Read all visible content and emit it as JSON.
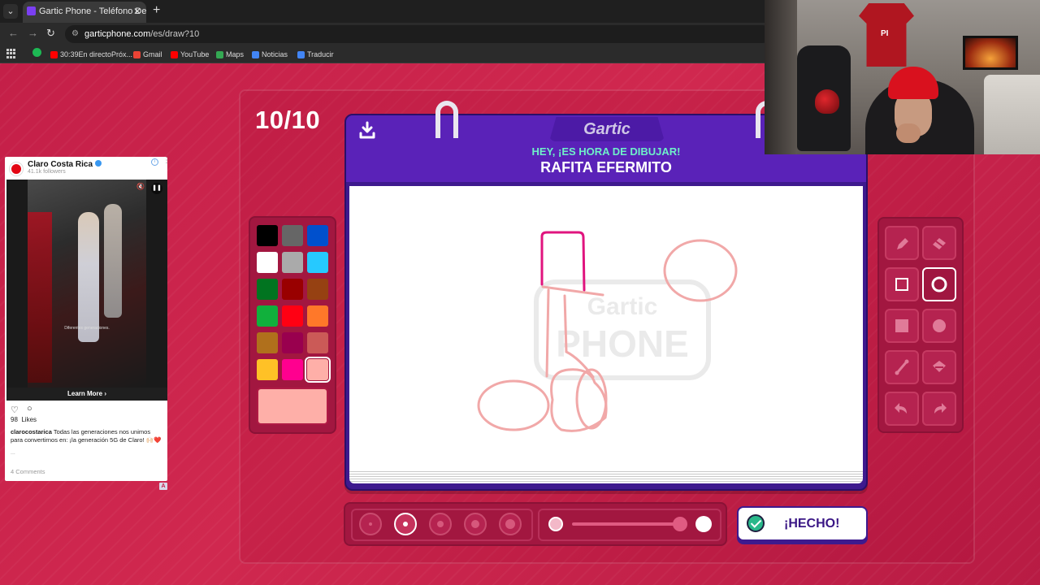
{
  "browser": {
    "tab_title": "Gartic Phone - Teléfono Descon",
    "tab_close": "✕",
    "new_tab": "+",
    "url_host": "garticphone.com",
    "url_path": "/es/draw?10",
    "bookmarks": [
      {
        "label": "30:39En directoPróx...",
        "color": "#ff0000"
      },
      {
        "label": "Gmail",
        "color": "#ea4335"
      },
      {
        "label": "YouTube",
        "color": "#ff0000"
      },
      {
        "label": "Maps",
        "color": "#34a853"
      },
      {
        "label": "Noticias",
        "color": "#4285f4"
      },
      {
        "label": "Traducir",
        "color": "#4285f4"
      }
    ]
  },
  "game": {
    "round": "10/10",
    "logo": "Gartic",
    "subtitle": "HEY, ¡ES HORA DE DIBUJAR!",
    "phrase": "RAFITA EFERMITO",
    "done_label": "¡HECHO!",
    "palette": [
      "#000000",
      "#666666",
      "#0050cd",
      "#ffffff",
      "#aaaaaa",
      "#26c9ff",
      "#017420",
      "#990000",
      "#964112",
      "#11b03c",
      "#ff0013",
      "#ff7829",
      "#b0701c",
      "#99004e",
      "#cb5a57",
      "#ffc126",
      "#ff008f",
      "#feafa8"
    ],
    "selected_color": "#feafa8",
    "tools": [
      "pencil-icon",
      "eraser-icon",
      "rectangle-outline-icon",
      "ellipse-outline-icon",
      "rectangle-fill-icon",
      "ellipse-fill-icon",
      "line-icon",
      "bucket-icon",
      "undo-icon",
      "redo-icon"
    ],
    "selected_tool": "ellipse-outline-icon",
    "brush_sizes": [
      1,
      2,
      3,
      4,
      5
    ],
    "selected_size": 2,
    "opacity": 1.0,
    "accent": "#5a22b8"
  },
  "ad": {
    "account": "Claro Costa Rica",
    "followers": "41.1k followers",
    "video_caption": "Diferentes generaciones.",
    "cta": "Learn More",
    "likes_count": "98",
    "likes_label": "Likes",
    "caption_user": "clarocostarica",
    "caption_text": "Todas las generaciones nos unimos para convertirnos en: ¡la generación 5G de Claro! 🙌🏻❤️",
    "comments": "4 Comments",
    "badge": "A"
  }
}
